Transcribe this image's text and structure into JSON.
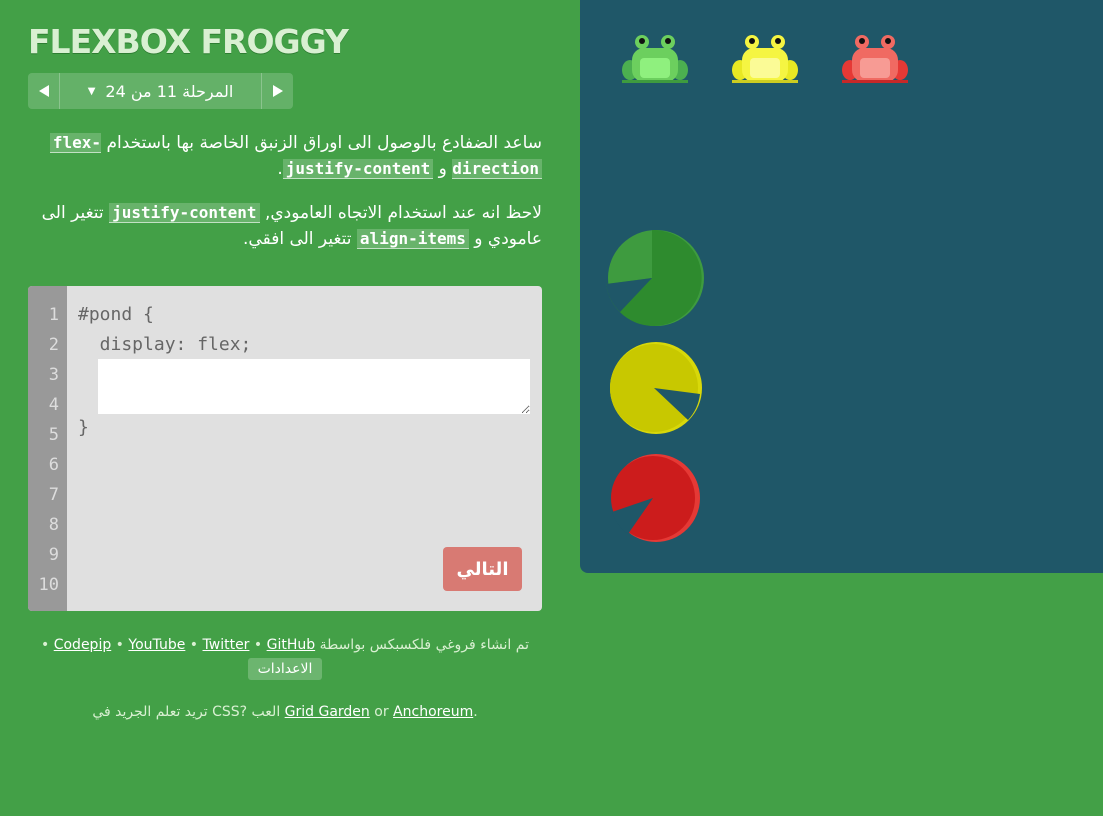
{
  "app": {
    "title": "FLEXBOX FROGGY"
  },
  "level": {
    "label": "المرحلة",
    "current": "11",
    "of_text": "من",
    "total": "24"
  },
  "instructions": {
    "p1_text": "ساعد الضفادع بالوصول الى اوراق الزنبق الخاصة بها باستخدام",
    "p1_code1": "flex-direction",
    "p1_and": "و",
    "p1_code2": "justify-content",
    "p2_prefix": "لاحظ انه عند استخدام الاتجاه العامودي,",
    "p2_code1": "justify-content",
    "p2_mid": "تتغير الى عامودي و",
    "p2_code2": "align-items",
    "p2_suffix": "تتغير الى افقي."
  },
  "editor": {
    "line_numbers": [
      "1",
      "2",
      "3",
      "4",
      "5",
      "6",
      "7",
      "8",
      "9",
      "10"
    ],
    "line1": "#pond {",
    "line2": "  display: flex;",
    "line5": "}",
    "input_value": "",
    "next_label": "التالي"
  },
  "footer": {
    "credit_text": "تم انشاء فروغي فلكسبكس بواسطة",
    "codepip": "Codepip",
    "youtube": "YouTube",
    "twitter": "Twitter",
    "github": "GitHub",
    "settings": "الاعدادات",
    "promo_text": "تريد تعلم الجريد في CSS? العب",
    "grid_garden": "Grid Garden",
    "or": "or",
    "anchoreum": "Anchoreum"
  },
  "colors": {
    "background": "#43a047",
    "pond": "#1f5768",
    "green": "#7ed36a",
    "yellow": "#f5f542",
    "red": "#f05a55",
    "next_button": "#d87a73"
  },
  "frogs": [
    {
      "color": "green",
      "icon": "frog-icon"
    },
    {
      "color": "yellow",
      "icon": "frog-icon"
    },
    {
      "color": "red",
      "icon": "frog-icon"
    }
  ],
  "lilypads": [
    {
      "color": "green",
      "icon": "lilypad-icon"
    },
    {
      "color": "yellow",
      "icon": "lilypad-icon"
    },
    {
      "color": "red",
      "icon": "lilypad-icon"
    }
  ]
}
